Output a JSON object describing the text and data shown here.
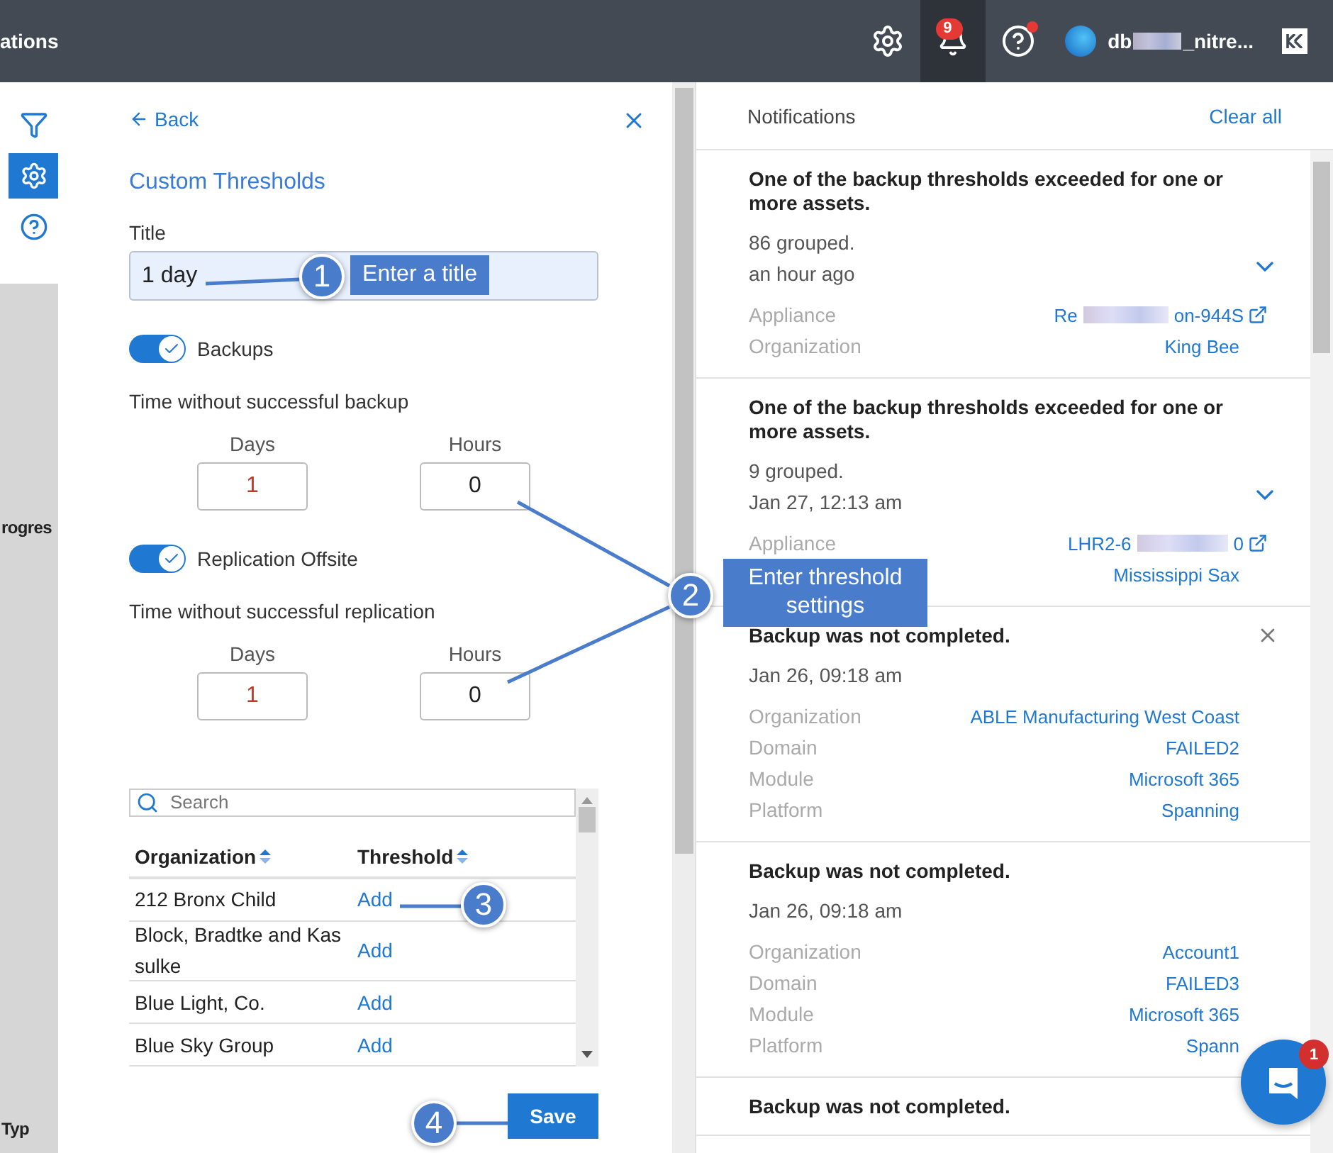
{
  "top_bar": {
    "title": "ations",
    "notification_count": "9",
    "help_alert": true,
    "user": {
      "name_start": "db",
      "name_end": "_nitre..."
    }
  },
  "side_rail": {
    "items": [
      {
        "kind": "filter",
        "selected": false
      },
      {
        "kind": "settings",
        "selected": true
      },
      {
        "kind": "help",
        "selected": false
      }
    ],
    "background_texts": [
      "rogres",
      "Typ"
    ]
  },
  "threshold_panel": {
    "back_label": "Back",
    "heading": "Custom Thresholds",
    "title_field": {
      "label": "Title",
      "value": "1 day"
    },
    "sections": [
      {
        "toggle_label": "Backups",
        "on": true,
        "caption": "Time without successful backup",
        "days_label": "Days",
        "days": "1",
        "hours_label": "Hours",
        "hours": "0"
      },
      {
        "toggle_label": "Replication Offsite",
        "on": true,
        "caption": "Time without successful replication",
        "days_label": "Days",
        "days": "1",
        "hours_label": "Hours",
        "hours": "0"
      }
    ],
    "search": {
      "placeholder": "Search"
    },
    "table": {
      "columns": [
        "Organization",
        "Threshold"
      ],
      "rows": [
        {
          "organization": "212 Bronx Child",
          "threshold": "Add"
        },
        {
          "organization": "Block, Bradtke and Kas sulke",
          "threshold": "Add"
        },
        {
          "organization": "Blue Light, Co.",
          "threshold": "Add"
        },
        {
          "organization": "Blue Sky Group",
          "threshold": "Add"
        }
      ]
    },
    "save_label": "Save"
  },
  "notifications": {
    "title": "Notifications",
    "clear_label": "Clear all",
    "items": [
      {
        "title": "One of the backup thresholds exceeded for one or more assets.",
        "meta": [
          "86 grouped.",
          "an hour ago"
        ],
        "expandable": true,
        "fields": [
          {
            "label": "Appliance",
            "value": "Re",
            "value_end": "on-944S",
            "external": true
          },
          {
            "label": "Organization",
            "value": "King Bee"
          }
        ]
      },
      {
        "title": "One of the backup thresholds exceeded for one or more assets.",
        "meta": [
          "9 grouped.",
          "Jan 27, 12:13 am"
        ],
        "expandable": true,
        "fields": [
          {
            "label": "Appliance",
            "value": "LHR2-6",
            "value_end": "0",
            "external": true
          },
          {
            "value": "Mississippi Sax"
          }
        ]
      },
      {
        "title": "Backup was not completed.",
        "meta": [
          "Jan 26, 09:18 am"
        ],
        "dismissible": true,
        "fields": [
          {
            "label": "Organization",
            "value": "ABLE Manufacturing West Coast"
          },
          {
            "label": "Domain",
            "value": "FAILED2"
          },
          {
            "label": "Module",
            "value": "Microsoft 365"
          },
          {
            "label": "Platform",
            "value": "Spanning"
          }
        ]
      },
      {
        "title": "Backup was not completed.",
        "meta": [
          "Jan 26, 09:18 am"
        ],
        "fields": [
          {
            "label": "Organization",
            "value": "Account1"
          },
          {
            "label": "Domain",
            "value": "FAILED3"
          },
          {
            "label": "Module",
            "value": "Microsoft 365"
          },
          {
            "label": "Platform",
            "value": "Spann"
          }
        ]
      },
      {
        "title": "Backup was not completed."
      }
    ]
  },
  "chat": {
    "badge": "1"
  },
  "callouts": [
    {
      "number": "1",
      "text": "Enter a title"
    },
    {
      "number": "2",
      "text": "Enter threshold settings"
    },
    {
      "number": "3"
    },
    {
      "number": "4"
    }
  ]
}
